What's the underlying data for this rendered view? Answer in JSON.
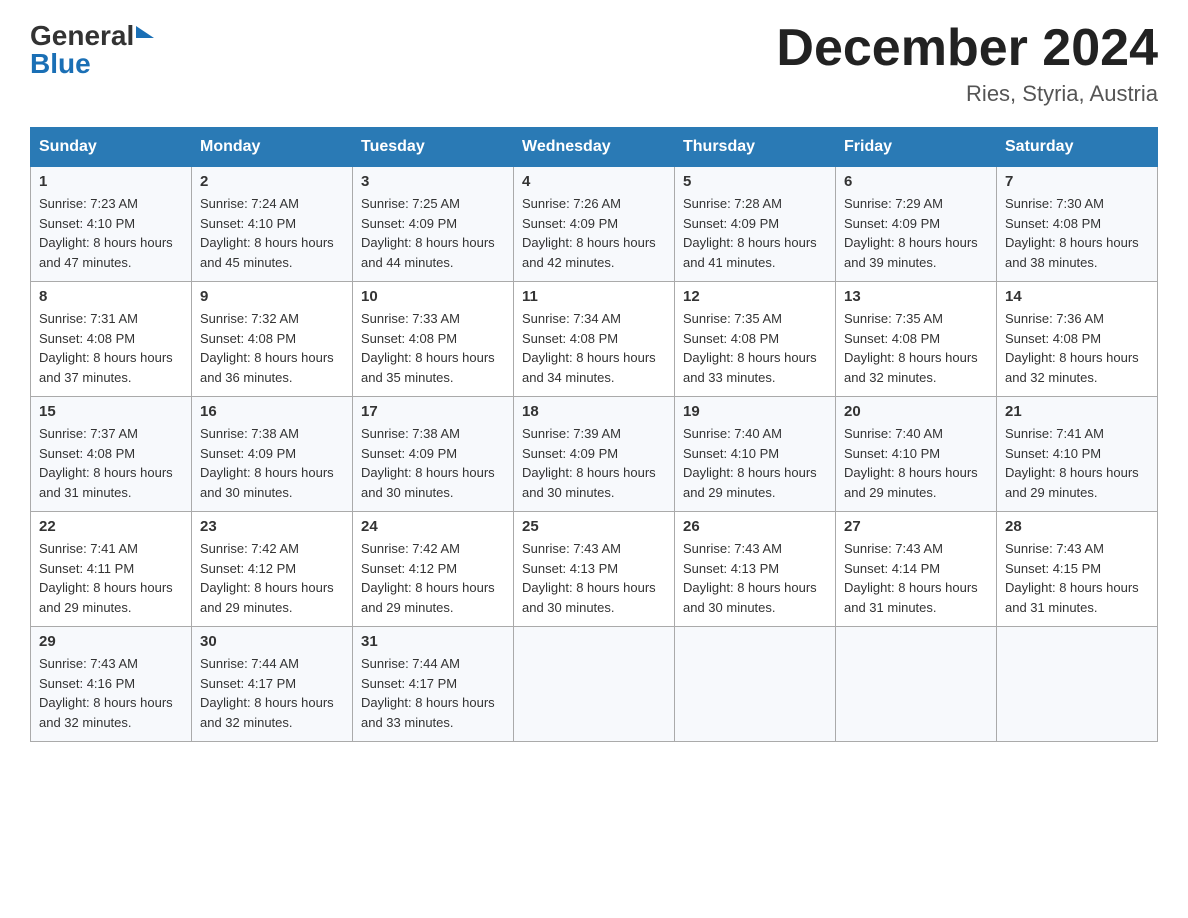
{
  "logo": {
    "general": "General",
    "blue": "Blue",
    "arrow_color": "#1a6fb5"
  },
  "title": {
    "month_year": "December 2024",
    "location": "Ries, Styria, Austria"
  },
  "header_color": "#2a7ab5",
  "days_of_week": [
    "Sunday",
    "Monday",
    "Tuesday",
    "Wednesday",
    "Thursday",
    "Friday",
    "Saturday"
  ],
  "weeks": [
    [
      {
        "day": "1",
        "sunrise": "7:23 AM",
        "sunset": "4:10 PM",
        "daylight": "8 hours and 47 minutes."
      },
      {
        "day": "2",
        "sunrise": "7:24 AM",
        "sunset": "4:10 PM",
        "daylight": "8 hours and 45 minutes."
      },
      {
        "day": "3",
        "sunrise": "7:25 AM",
        "sunset": "4:09 PM",
        "daylight": "8 hours and 44 minutes."
      },
      {
        "day": "4",
        "sunrise": "7:26 AM",
        "sunset": "4:09 PM",
        "daylight": "8 hours and 42 minutes."
      },
      {
        "day": "5",
        "sunrise": "7:28 AM",
        "sunset": "4:09 PM",
        "daylight": "8 hours and 41 minutes."
      },
      {
        "day": "6",
        "sunrise": "7:29 AM",
        "sunset": "4:09 PM",
        "daylight": "8 hours and 39 minutes."
      },
      {
        "day": "7",
        "sunrise": "7:30 AM",
        "sunset": "4:08 PM",
        "daylight": "8 hours and 38 minutes."
      }
    ],
    [
      {
        "day": "8",
        "sunrise": "7:31 AM",
        "sunset": "4:08 PM",
        "daylight": "8 hours and 37 minutes."
      },
      {
        "day": "9",
        "sunrise": "7:32 AM",
        "sunset": "4:08 PM",
        "daylight": "8 hours and 36 minutes."
      },
      {
        "day": "10",
        "sunrise": "7:33 AM",
        "sunset": "4:08 PM",
        "daylight": "8 hours and 35 minutes."
      },
      {
        "day": "11",
        "sunrise": "7:34 AM",
        "sunset": "4:08 PM",
        "daylight": "8 hours and 34 minutes."
      },
      {
        "day": "12",
        "sunrise": "7:35 AM",
        "sunset": "4:08 PM",
        "daylight": "8 hours and 33 minutes."
      },
      {
        "day": "13",
        "sunrise": "7:35 AM",
        "sunset": "4:08 PM",
        "daylight": "8 hours and 32 minutes."
      },
      {
        "day": "14",
        "sunrise": "7:36 AM",
        "sunset": "4:08 PM",
        "daylight": "8 hours and 32 minutes."
      }
    ],
    [
      {
        "day": "15",
        "sunrise": "7:37 AM",
        "sunset": "4:08 PM",
        "daylight": "8 hours and 31 minutes."
      },
      {
        "day": "16",
        "sunrise": "7:38 AM",
        "sunset": "4:09 PM",
        "daylight": "8 hours and 30 minutes."
      },
      {
        "day": "17",
        "sunrise": "7:38 AM",
        "sunset": "4:09 PM",
        "daylight": "8 hours and 30 minutes."
      },
      {
        "day": "18",
        "sunrise": "7:39 AM",
        "sunset": "4:09 PM",
        "daylight": "8 hours and 30 minutes."
      },
      {
        "day": "19",
        "sunrise": "7:40 AM",
        "sunset": "4:10 PM",
        "daylight": "8 hours and 29 minutes."
      },
      {
        "day": "20",
        "sunrise": "7:40 AM",
        "sunset": "4:10 PM",
        "daylight": "8 hours and 29 minutes."
      },
      {
        "day": "21",
        "sunrise": "7:41 AM",
        "sunset": "4:10 PM",
        "daylight": "8 hours and 29 minutes."
      }
    ],
    [
      {
        "day": "22",
        "sunrise": "7:41 AM",
        "sunset": "4:11 PM",
        "daylight": "8 hours and 29 minutes."
      },
      {
        "day": "23",
        "sunrise": "7:42 AM",
        "sunset": "4:12 PM",
        "daylight": "8 hours and 29 minutes."
      },
      {
        "day": "24",
        "sunrise": "7:42 AM",
        "sunset": "4:12 PM",
        "daylight": "8 hours and 29 minutes."
      },
      {
        "day": "25",
        "sunrise": "7:43 AM",
        "sunset": "4:13 PM",
        "daylight": "8 hours and 30 minutes."
      },
      {
        "day": "26",
        "sunrise": "7:43 AM",
        "sunset": "4:13 PM",
        "daylight": "8 hours and 30 minutes."
      },
      {
        "day": "27",
        "sunrise": "7:43 AM",
        "sunset": "4:14 PM",
        "daylight": "8 hours and 31 minutes."
      },
      {
        "day": "28",
        "sunrise": "7:43 AM",
        "sunset": "4:15 PM",
        "daylight": "8 hours and 31 minutes."
      }
    ],
    [
      {
        "day": "29",
        "sunrise": "7:43 AM",
        "sunset": "4:16 PM",
        "daylight": "8 hours and 32 minutes."
      },
      {
        "day": "30",
        "sunrise": "7:44 AM",
        "sunset": "4:17 PM",
        "daylight": "8 hours and 32 minutes."
      },
      {
        "day": "31",
        "sunrise": "7:44 AM",
        "sunset": "4:17 PM",
        "daylight": "8 hours and 33 minutes."
      },
      {
        "day": "",
        "sunrise": "",
        "sunset": "",
        "daylight": ""
      },
      {
        "day": "",
        "sunrise": "",
        "sunset": "",
        "daylight": ""
      },
      {
        "day": "",
        "sunrise": "",
        "sunset": "",
        "daylight": ""
      },
      {
        "day": "",
        "sunrise": "",
        "sunset": "",
        "daylight": ""
      }
    ]
  ],
  "labels": {
    "sunrise_prefix": "Sunrise: ",
    "sunset_prefix": "Sunset: ",
    "daylight_prefix": "Daylight: "
  }
}
